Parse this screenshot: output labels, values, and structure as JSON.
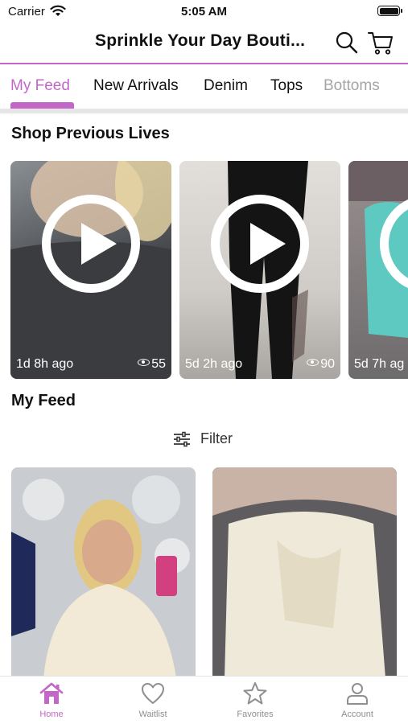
{
  "status_bar": {
    "carrier": "Carrier",
    "time": "5:05 AM"
  },
  "header": {
    "title": "Sprinkle Your Day Bouti...",
    "search_icon": "search-icon",
    "cart_icon": "cart-icon"
  },
  "tabs": [
    {
      "label": "My Feed",
      "active": true
    },
    {
      "label": "New Arrivals"
    },
    {
      "label": "Denim"
    },
    {
      "label": "Tops"
    },
    {
      "label": "Bottoms"
    }
  ],
  "previous_lives": {
    "title": "Shop Previous Lives",
    "items": [
      {
        "ago": "1d 8h ago",
        "views": "55"
      },
      {
        "ago": "5d 2h ago",
        "views": "90"
      },
      {
        "ago": "5d 7h ag",
        "views": ""
      }
    ]
  },
  "feed": {
    "title": "My Feed",
    "filter_label": "Filter"
  },
  "bottom_nav": [
    {
      "label": "Home",
      "icon": "home-icon",
      "active": true
    },
    {
      "label": "Waitlist",
      "icon": "heart-icon"
    },
    {
      "label": "Favorites",
      "icon": "star-icon"
    },
    {
      "label": "Account",
      "icon": "account-icon"
    }
  ],
  "colors": {
    "accent": "#c267c8",
    "divider": "#e6e6e6"
  }
}
